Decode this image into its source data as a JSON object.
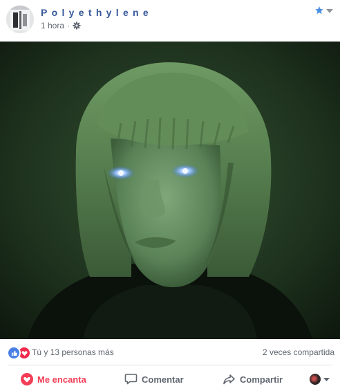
{
  "post": {
    "page_name": "Polyethylene",
    "timestamp": "1 hora",
    "separator": "·",
    "privacy_icon": "gear-icon",
    "header_icons": [
      "star-icon",
      "chevron-down-icon"
    ]
  },
  "stats": {
    "reaction_icons": [
      "like-icon",
      "love-icon"
    ],
    "reactions_text": "Tú y 13 personas más",
    "shares_text": "2 veces compartida"
  },
  "actions": {
    "love_label": "Me encanta",
    "comment_label": "Comentar",
    "share_label": "Compartir"
  },
  "colors": {
    "page_name": "#365899",
    "love": "#f33e58",
    "like": "#4a7fe6",
    "muted_text": "#606770"
  }
}
